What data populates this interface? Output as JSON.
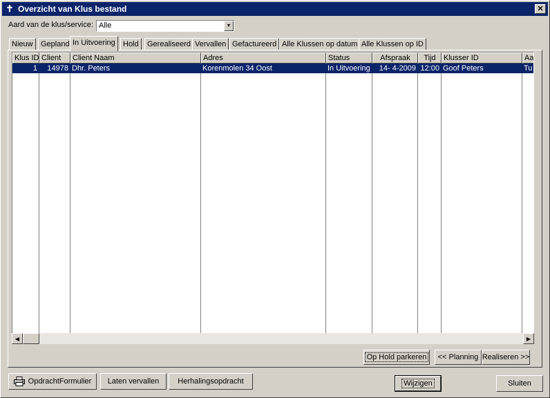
{
  "window": {
    "title": "Overzicht van Klus bestand",
    "close_glyph": "✕"
  },
  "filter": {
    "label": "Aard van de klus/service:",
    "value": "Alle"
  },
  "tabs": [
    {
      "label": "Nieuw"
    },
    {
      "label": "Gepland"
    },
    {
      "label": "In Uitvoering"
    },
    {
      "label": "Hold"
    },
    {
      "label": "Gerealiseerd"
    },
    {
      "label": "Vervallen"
    },
    {
      "label": "Gefactureerd"
    },
    {
      "label": "Alle Klussen op datum"
    },
    {
      "label": "Alle Klussen op ID"
    }
  ],
  "active_tab": "In Uitvoering",
  "table": {
    "columns": [
      "Klus ID",
      "Client",
      "Client Naam",
      "Adres",
      "Status",
      "Afspraak",
      "Tijd",
      "Klusser ID",
      "Aa"
    ],
    "rows": [
      {
        "klus_id": "1",
        "client": "14978",
        "client_naam": "Dhr. Peters",
        "adres": "Korenmolen 34 Oost",
        "status": "In Uitvoering",
        "afspraak": "14- 4-2009",
        "tijd": "12:00",
        "klusser_id": "Goof Peters",
        "extra": "Tu"
      }
    ]
  },
  "actions": {
    "hold": "Op Hold parkeren",
    "planning": "<< Planning",
    "realiseren": "Realiseren >>"
  },
  "footer": {
    "opdracht_formulier": "OpdrachtFormulier",
    "laten_vervallen": "Laten vervallen",
    "herhalingsopdracht": "Herhalingsopdracht",
    "wijzigen": "Wijzigen",
    "sluiten": "Sluiten"
  },
  "icons": {
    "app": "pin-icon",
    "print": "printer-icon"
  },
  "colors": {
    "titlebar": "#0a246a",
    "selection": "#0a246a",
    "face": "#d4d0c8"
  }
}
